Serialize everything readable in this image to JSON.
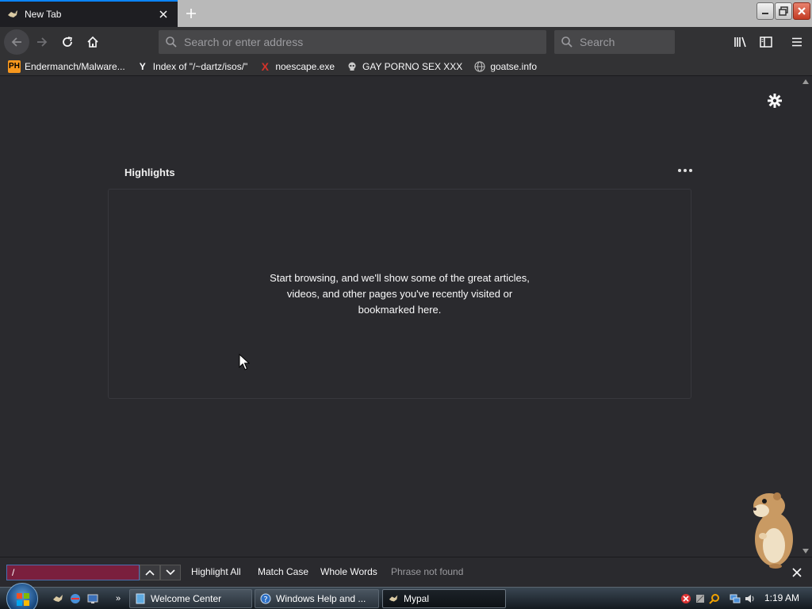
{
  "browser": {
    "tab": {
      "title": "New Tab"
    },
    "urlbar": {
      "placeholder": "Search or enter address"
    },
    "searchbar": {
      "placeholder": "Search"
    },
    "bookmarks": [
      {
        "label": "Endermanch/Malware...",
        "icon": "PH",
        "icon_color": "#f7971d"
      },
      {
        "label": "Index of \"/~dartz/isos/\"",
        "icon": "Y",
        "icon_color": "#ffffff"
      },
      {
        "label": "noescape.exe",
        "icon": "X",
        "icon_color": "#d4332a"
      },
      {
        "label": "GAY PORNO SEX XXX",
        "icon": "skull",
        "icon_color": "#cccccc"
      },
      {
        "label": "goatse.info",
        "icon": "globe",
        "icon_color": "#bbbbbb"
      }
    ]
  },
  "newtab": {
    "highlights_title": "Highlights",
    "empty_message": "Start browsing, and we'll show some of the great articles, videos, and other pages you've recently visited or bookmarked here."
  },
  "findbar": {
    "query": "/",
    "highlight_all": "Highlight All",
    "match_case": "Match Case",
    "whole_words": "Whole Words",
    "status": "Phrase not found"
  },
  "taskbar": {
    "buttons": [
      {
        "label": "Welcome Center"
      },
      {
        "label": "Windows Help and ..."
      },
      {
        "label": "Mypal"
      }
    ],
    "clock": "1:19 AM"
  },
  "colors": {
    "accent": "#0a84ff",
    "page_bg": "#2a2a2e",
    "toolbar_bg": "#323234",
    "find_field_bg": "#7a1f3d"
  }
}
